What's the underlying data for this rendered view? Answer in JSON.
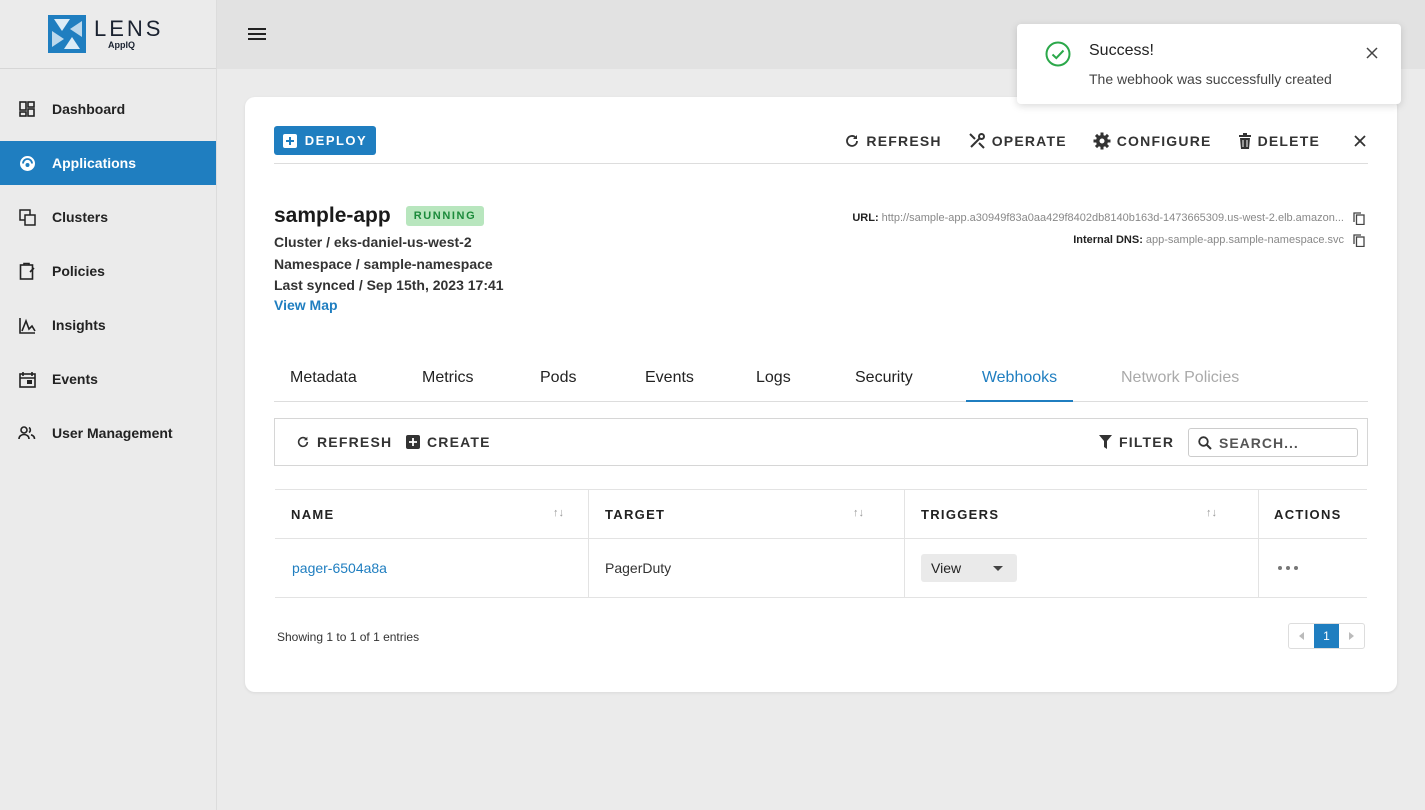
{
  "brand": {
    "name": "LENS",
    "sub": "AppIQ",
    "color": "#1f7ec0"
  },
  "sidebar": {
    "items": [
      {
        "label": "Dashboard",
        "icon": "dashboard-icon",
        "active": false
      },
      {
        "label": "Applications",
        "icon": "applications-icon",
        "active": true
      },
      {
        "label": "Clusters",
        "icon": "clusters-icon",
        "active": false
      },
      {
        "label": "Policies",
        "icon": "policies-icon",
        "active": false
      },
      {
        "label": "Insights",
        "icon": "insights-icon",
        "active": false
      },
      {
        "label": "Events",
        "icon": "events-icon",
        "active": false
      },
      {
        "label": "User Management",
        "icon": "users-icon",
        "active": false
      }
    ]
  },
  "toolbar": {
    "deploy_label": "DEPLOY",
    "refresh_label": "REFRESH",
    "operate_label": "OPERATE",
    "configure_label": "CONFIGURE",
    "delete_label": "DELETE"
  },
  "app": {
    "name": "sample-app",
    "status": "RUNNING",
    "cluster_line": "Cluster / eks-daniel-us-west-2",
    "namespace_line": "Namespace / sample-namespace",
    "synced_line": "Last synced / Sep 15th, 2023 17:41",
    "view_map_label": "View Map",
    "url_label": "URL:",
    "url_value": "http://sample-app.a30949f83a0aa429f8402db8140b163d-1473665309.us-west-2.elb.amazon...",
    "dns_label": "Internal DNS:",
    "dns_value": "app-sample-app.sample-namespace.svc"
  },
  "tabs": [
    {
      "label": "Metadata",
      "state": "normal"
    },
    {
      "label": "Metrics",
      "state": "normal"
    },
    {
      "label": "Pods",
      "state": "normal"
    },
    {
      "label": "Events",
      "state": "normal"
    },
    {
      "label": "Logs",
      "state": "normal"
    },
    {
      "label": "Security",
      "state": "normal"
    },
    {
      "label": "Webhooks",
      "state": "active"
    },
    {
      "label": "Network Policies",
      "state": "disabled"
    }
  ],
  "grid": {
    "refresh_label": "REFRESH",
    "create_label": "CREATE",
    "filter_label": "FILTER",
    "search_placeholder": "SEARCH..."
  },
  "table": {
    "columns": [
      "NAME",
      "TARGET",
      "TRIGGERS",
      "ACTIONS"
    ],
    "rows": [
      {
        "name": "pager-6504a8a",
        "target": "PagerDuty",
        "triggers": "View"
      }
    ],
    "entries_text": "Showing 1 to 1 of 1 entries",
    "current_page": "1"
  },
  "toast": {
    "title": "Success!",
    "message": "The webhook was successfully created",
    "status_color": "#2ba84a"
  }
}
